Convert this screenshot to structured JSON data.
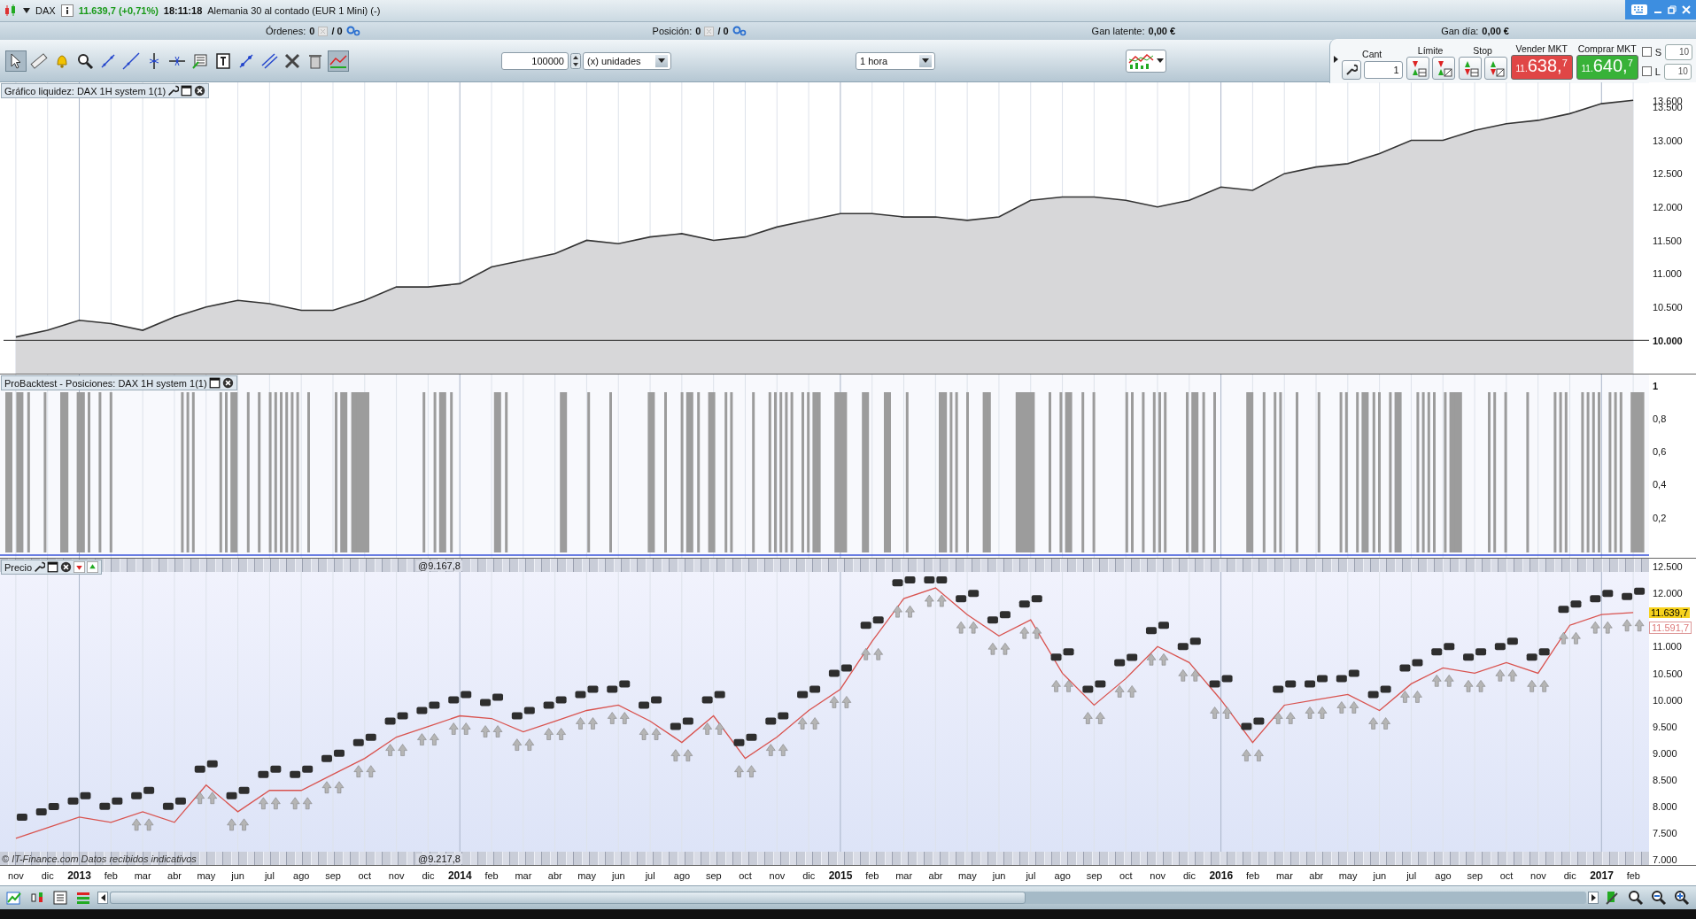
{
  "title_bar": {
    "symbol": "DAX",
    "price": "11.639,7 (+0,71%)",
    "time": "18:11:18",
    "description": "Alemania 30 al contado (EUR 1 Mini) (-)"
  },
  "account_bar": [
    {
      "label": "Órdenes:",
      "value": "0",
      "total": "/ 0",
      "kind": "orders"
    },
    {
      "label": "Posición:",
      "value": "0",
      "total": "/ 0",
      "kind": "orders"
    },
    {
      "label": "Gan latente:",
      "value": "0,00 €",
      "kind": "plain"
    },
    {
      "label": "Gan día:",
      "value": "0,00 €",
      "kind": "plain"
    }
  ],
  "tools": [
    {
      "selected": true
    },
    {
      "selected": false
    },
    {
      "selected": false
    },
    {
      "selected": false
    },
    {
      "selected": false
    },
    {
      "selected": false
    },
    {
      "selected": false
    },
    {
      "selected": false
    },
    {
      "selected": false
    },
    {
      "selected": false
    },
    {
      "selected": false
    },
    {
      "selected": false
    },
    {
      "selected": false
    },
    {
      "selected": false
    },
    {
      "selected": true
    }
  ],
  "quantity": {
    "value": "100000",
    "unit": "(x) unidades"
  },
  "timeframe": "1 hora",
  "order_panel": {
    "cant_label": "Cant",
    "cant_value": "1",
    "limit_label": "Límite",
    "stop_label": "Stop",
    "sell": {
      "label": "Vender MKT",
      "prefix": "11.",
      "main": "638,",
      "suffix": "7"
    },
    "buy": {
      "label": "Comprar MKT",
      "prefix": "11.",
      "main": "640,",
      "suffix": "7"
    },
    "options": [
      {
        "label": "S",
        "checked": false,
        "value": "10"
      },
      {
        "label": "L",
        "checked": false,
        "value": "10"
      }
    ]
  },
  "equity_panel": {
    "title": "Gráfico liquidez: DAX 1H system 1(1)",
    "chart_data": {
      "type": "area",
      "ylim": [
        9500,
        13870
      ],
      "grid": true,
      "categories": [
        null,
        null,
        null,
        null,
        null,
        null,
        null,
        null,
        null,
        null,
        null,
        null,
        null,
        null,
        null,
        null,
        null,
        null,
        null,
        null,
        null,
        null,
        null,
        null,
        null,
        null,
        null,
        null,
        null,
        null,
        null,
        null,
        null,
        null,
        null,
        null,
        null,
        null,
        null,
        null,
        null,
        null,
        null,
        null,
        null,
        null,
        null,
        null,
        null,
        null,
        null,
        null
      ],
      "yticks": [
        {
          "value": 13600,
          "label": "13.600"
        },
        {
          "value": 13500,
          "label": "13.500"
        },
        {
          "value": 13000,
          "label": "13.000"
        },
        {
          "value": 12500,
          "label": "12.500"
        },
        {
          "value": 12000,
          "label": "12.000"
        },
        {
          "value": 11500,
          "label": "11.500"
        },
        {
          "value": 11000,
          "label": "11.000"
        },
        {
          "value": 10500,
          "label": "10.500"
        },
        {
          "value": 10000,
          "label": "10.000"
        }
      ],
      "series": [
        {
          "color": "#333333",
          "values": [
            10050,
            10150,
            10300,
            10250,
            10150,
            10350,
            10500,
            10600,
            10550,
            10450,
            10450,
            10600,
            10800,
            10800,
            10850,
            11100,
            11200,
            11300,
            11500,
            11450,
            11550,
            11600,
            11500,
            11550,
            11700,
            11800,
            11900,
            11900,
            11850,
            11850,
            11800,
            11850,
            12100,
            12150,
            12150,
            12100,
            12000,
            12100,
            12300,
            12250,
            12500,
            12600,
            12650,
            12800,
            13000,
            13000,
            13150,
            13250,
            13300,
            13400,
            13550,
            13600
          ]
        }
      ]
    }
  },
  "positions_panel": {
    "title": "ProBacktest - Posiciones: DAX 1H system 1(1)",
    "axis_labels": [
      "1",
      "0,8",
      "0,6",
      "0,4",
      "0,2"
    ]
  },
  "price_panel": {
    "title": "Precio",
    "trade_labels_top": [
      "@9.167,8"
    ],
    "trade_labels_bottom": [
      "@9.217,8"
    ],
    "chart_data": {
      "type": "line",
      "ylim": [
        6900,
        12650
      ],
      "grid": true,
      "yticks": [
        {
          "value": 12500,
          "label": "12.500"
        },
        {
          "value": 12000,
          "label": "12.000"
        },
        {
          "value": 11000,
          "label": "11.000"
        },
        {
          "value": 10500,
          "label": "10.500"
        },
        {
          "value": 10000,
          "label": "10.000"
        },
        {
          "value": 9500,
          "label": "9.500"
        },
        {
          "value": 9000,
          "label": "9.000"
        },
        {
          "value": 8500,
          "label": "8.500"
        },
        {
          "value": 8000,
          "label": "8.000"
        },
        {
          "value": 7500,
          "label": "7.500"
        },
        {
          "value": 7000,
          "label": "7.000"
        }
      ],
      "series": [
        {
          "color": "#d9534f",
          "values": [
            7400,
            7600,
            7800,
            7700,
            7900,
            7700,
            8400,
            7900,
            8300,
            8300,
            8600,
            8900,
            9300,
            9500,
            9700,
            9650,
            9400,
            9600,
            9800,
            9900,
            9600,
            9200,
            9700,
            8900,
            9300,
            9800,
            10200,
            11100,
            11900,
            12100,
            11600,
            11200,
            11500,
            10500,
            9900,
            10400,
            11000,
            10700,
            10000,
            9200,
            9900,
            10000,
            10100,
            9800,
            10300,
            10600,
            10500,
            10700,
            10500,
            11400,
            11600,
            11640
          ]
        }
      ]
    },
    "price_tags": [
      {
        "label": "11.639,7",
        "kind": "last"
      },
      {
        "label": "11.591,7",
        "kind": "other"
      }
    ],
    "footer_note": "© IT-Finance.com Datos recibidos indicativos"
  },
  "time_axis": [
    {
      "label": "nov",
      "kind": "month"
    },
    {
      "label": "dic",
      "kind": "month"
    },
    {
      "label": "2013",
      "kind": "year"
    },
    {
      "label": "feb",
      "kind": "month"
    },
    {
      "label": "mar",
      "kind": "month"
    },
    {
      "label": "abr",
      "kind": "month"
    },
    {
      "label": "may",
      "kind": "month"
    },
    {
      "label": "jun",
      "kind": "month"
    },
    {
      "label": "jul",
      "kind": "month"
    },
    {
      "label": "ago",
      "kind": "month"
    },
    {
      "label": "sep",
      "kind": "month"
    },
    {
      "label": "oct",
      "kind": "month"
    },
    {
      "label": "nov",
      "kind": "month"
    },
    {
      "label": "dic",
      "kind": "month"
    },
    {
      "label": "2014",
      "kind": "year"
    },
    {
      "label": "feb",
      "kind": "month"
    },
    {
      "label": "mar",
      "kind": "month"
    },
    {
      "label": "abr",
      "kind": "month"
    },
    {
      "label": "may",
      "kind": "month"
    },
    {
      "label": "jun",
      "kind": "month"
    },
    {
      "label": "jul",
      "kind": "month"
    },
    {
      "label": "ago",
      "kind": "month"
    },
    {
      "label": "sep",
      "kind": "month"
    },
    {
      "label": "oct",
      "kind": "month"
    },
    {
      "label": "nov",
      "kind": "month"
    },
    {
      "label": "dic",
      "kind": "month"
    },
    {
      "label": "2015",
      "kind": "year"
    },
    {
      "label": "feb",
      "kind": "month"
    },
    {
      "label": "mar",
      "kind": "month"
    },
    {
      "label": "abr",
      "kind": "month"
    },
    {
      "label": "may",
      "kind": "month"
    },
    {
      "label": "jun",
      "kind": "month"
    },
    {
      "label": "jul",
      "kind": "month"
    },
    {
      "label": "ago",
      "kind": "month"
    },
    {
      "label": "sep",
      "kind": "month"
    },
    {
      "label": "oct",
      "kind": "month"
    },
    {
      "label": "nov",
      "kind": "month"
    },
    {
      "label": "dic",
      "kind": "month"
    },
    {
      "label": "2016",
      "kind": "year"
    },
    {
      "label": "feb",
      "kind": "month"
    },
    {
      "label": "mar",
      "kind": "month"
    },
    {
      "label": "abr",
      "kind": "month"
    },
    {
      "label": "may",
      "kind": "month"
    },
    {
      "label": "jun",
      "kind": "month"
    },
    {
      "label": "jul",
      "kind": "month"
    },
    {
      "label": "ago",
      "kind": "month"
    },
    {
      "label": "sep",
      "kind": "month"
    },
    {
      "label": "oct",
      "kind": "month"
    },
    {
      "label": "nov",
      "kind": "month"
    },
    {
      "label": "dic",
      "kind": "month"
    },
    {
      "label": "2017",
      "kind": "year"
    },
    {
      "label": "feb",
      "kind": "month"
    }
  ]
}
